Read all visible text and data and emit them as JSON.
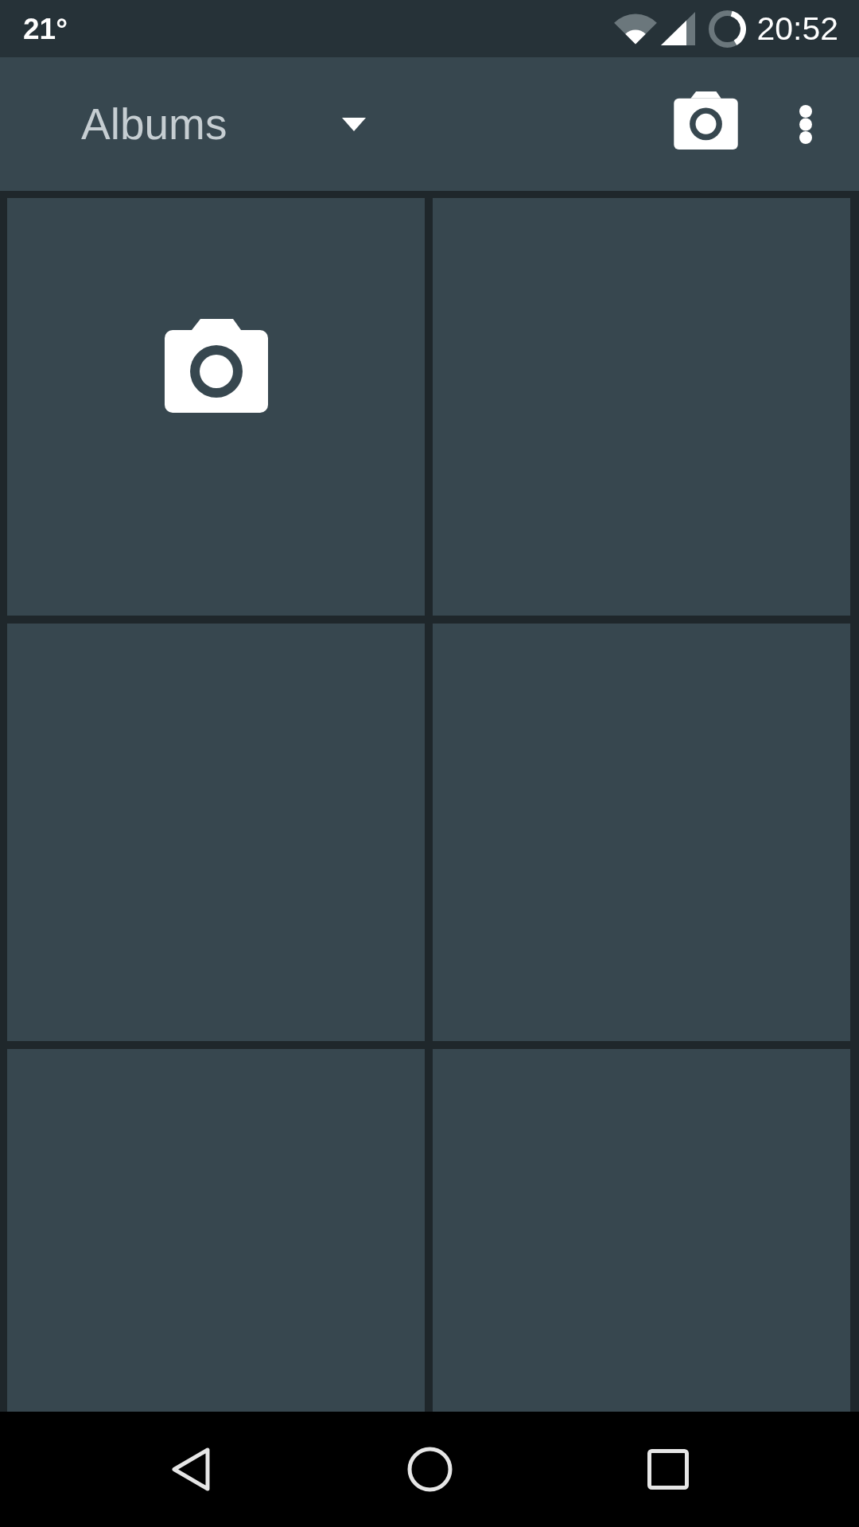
{
  "status_bar": {
    "temperature": "21°",
    "time": "20:52"
  },
  "toolbar": {
    "title": "Albums"
  },
  "tiles": [
    {
      "kind": "camera"
    },
    {
      "kind": "empty"
    },
    {
      "kind": "empty"
    },
    {
      "kind": "empty"
    },
    {
      "kind": "empty"
    },
    {
      "kind": "empty"
    }
  ]
}
